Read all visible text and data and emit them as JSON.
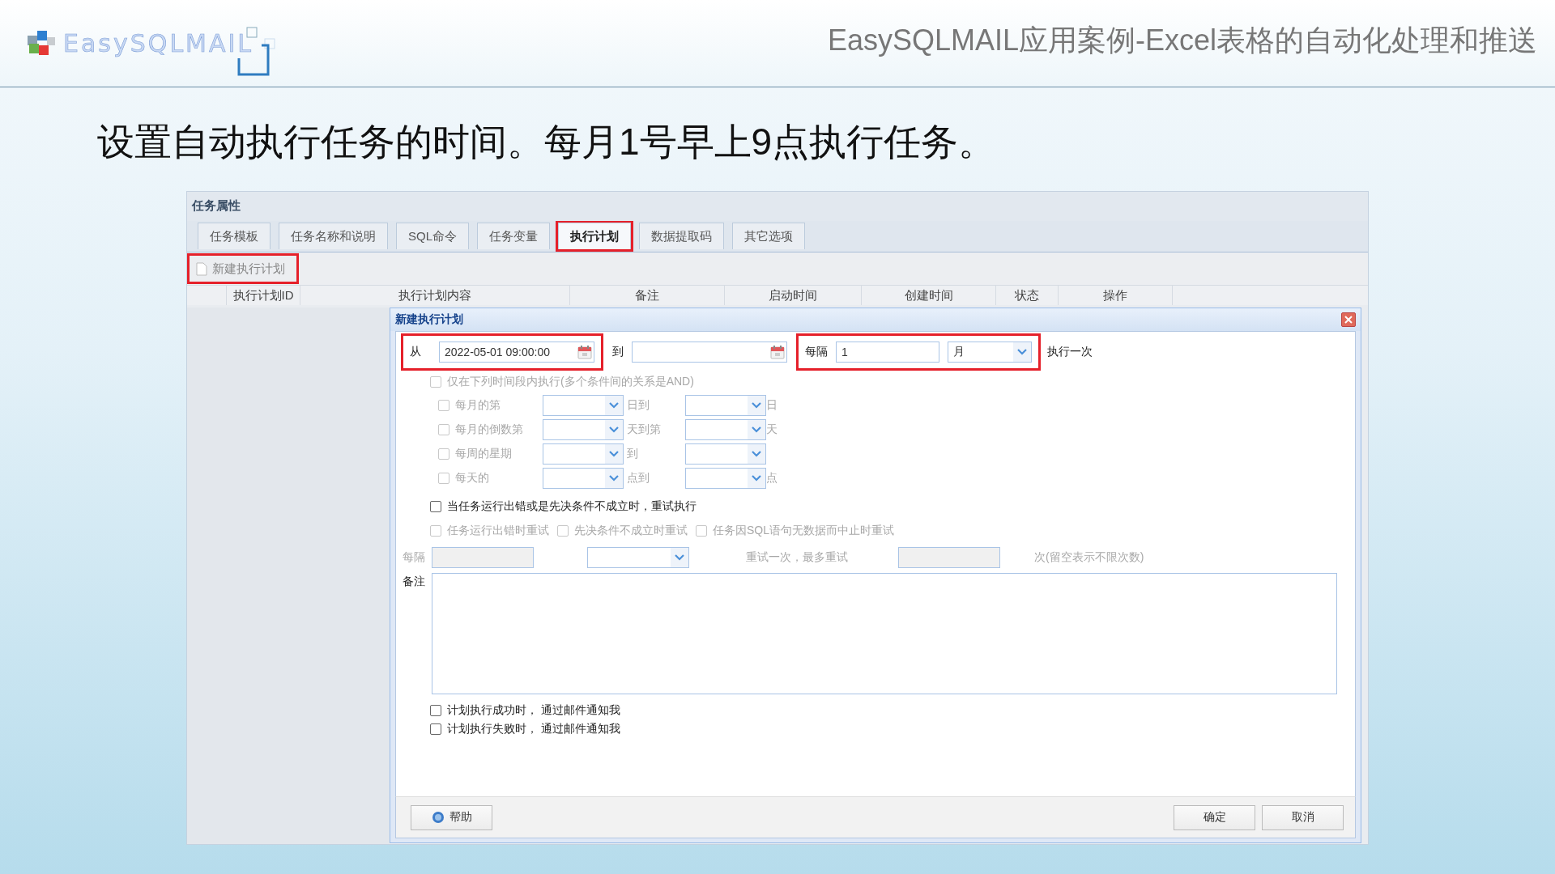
{
  "slide": {
    "logo_text": "EasySQLMAIL",
    "title": "EasySQLMAIL应用案例-Excel表格的自动化处理和推送",
    "heading": "设置自动执行任务的时间。每月1号早上9点执行任务。"
  },
  "window": {
    "title": "任务属性",
    "tabs": [
      {
        "label": "任务模板",
        "selected": false,
        "highlighted": false
      },
      {
        "label": "任务名称和说明",
        "selected": false,
        "highlighted": false
      },
      {
        "label": "SQL命令",
        "selected": false,
        "highlighted": false
      },
      {
        "label": "任务变量",
        "selected": false,
        "highlighted": false
      },
      {
        "label": "执行计划",
        "selected": true,
        "highlighted": true
      },
      {
        "label": "数据提取码",
        "selected": false,
        "highlighted": false
      },
      {
        "label": "其它选项",
        "selected": false,
        "highlighted": false
      }
    ],
    "toolbar": {
      "label": "新建执行计划",
      "disabled": true,
      "highlighted": true
    },
    "columns": [
      "执行计划ID",
      "执行计划内容",
      "备注",
      "启动时间",
      "创建时间",
      "状态",
      "操作"
    ]
  },
  "dialog": {
    "title": "新建执行计划",
    "from": {
      "label": "从",
      "value": "2022-05-01 09:00:00",
      "highlighted": true
    },
    "to": {
      "label": "到",
      "highlighted": false
    },
    "interval": {
      "label": "每隔",
      "value": "1",
      "unit": "月",
      "suffix": "执行一次",
      "highlighted": true
    },
    "time_window": {
      "label": "仅在下列时间段内执行(多个条件间的关系是AND)",
      "checked": false,
      "disabled": true
    },
    "conditions": [
      {
        "label": "每月的第",
        "middle": "日到",
        "end": "日",
        "checked": false,
        "disabled": true
      },
      {
        "label": "每月的倒数第",
        "middle": "天到第",
        "end": "天",
        "checked": false,
        "disabled": true
      },
      {
        "label": "每周的星期",
        "middle": "到",
        "checked": false,
        "disabled": true
      },
      {
        "label": "每天的",
        "middle": "点到",
        "end": "点",
        "checked": false,
        "disabled": true
      }
    ],
    "retry": {
      "label": "当任务运行出错或是先决条件不成立时，重试执行",
      "checked": false,
      "disabled": false
    },
    "retry_options": [
      {
        "label": "任务运行出错时重试",
        "checked": false,
        "disabled": true
      },
      {
        "label": "先决条件不成立时重试",
        "checked": false,
        "disabled": true
      },
      {
        "label": "任务因SQL语句无数据而中止时重试",
        "checked": false,
        "disabled": true
      }
    ],
    "retry_interval": {
      "label": "每隔",
      "middle": "重试一次，最多重试",
      "suffix": "次(留空表示不限次数)",
      "disabled": true
    },
    "note": {
      "label": "备注"
    },
    "notify": [
      {
        "label": "计划执行成功时， 通过邮件通知我",
        "checked": false,
        "disabled": false
      },
      {
        "label": "计划执行失败时， 通过邮件通知我",
        "checked": false,
        "disabled": false
      }
    ],
    "buttons": {
      "help": "帮助",
      "ok": "确定",
      "cancel": "取消"
    }
  }
}
